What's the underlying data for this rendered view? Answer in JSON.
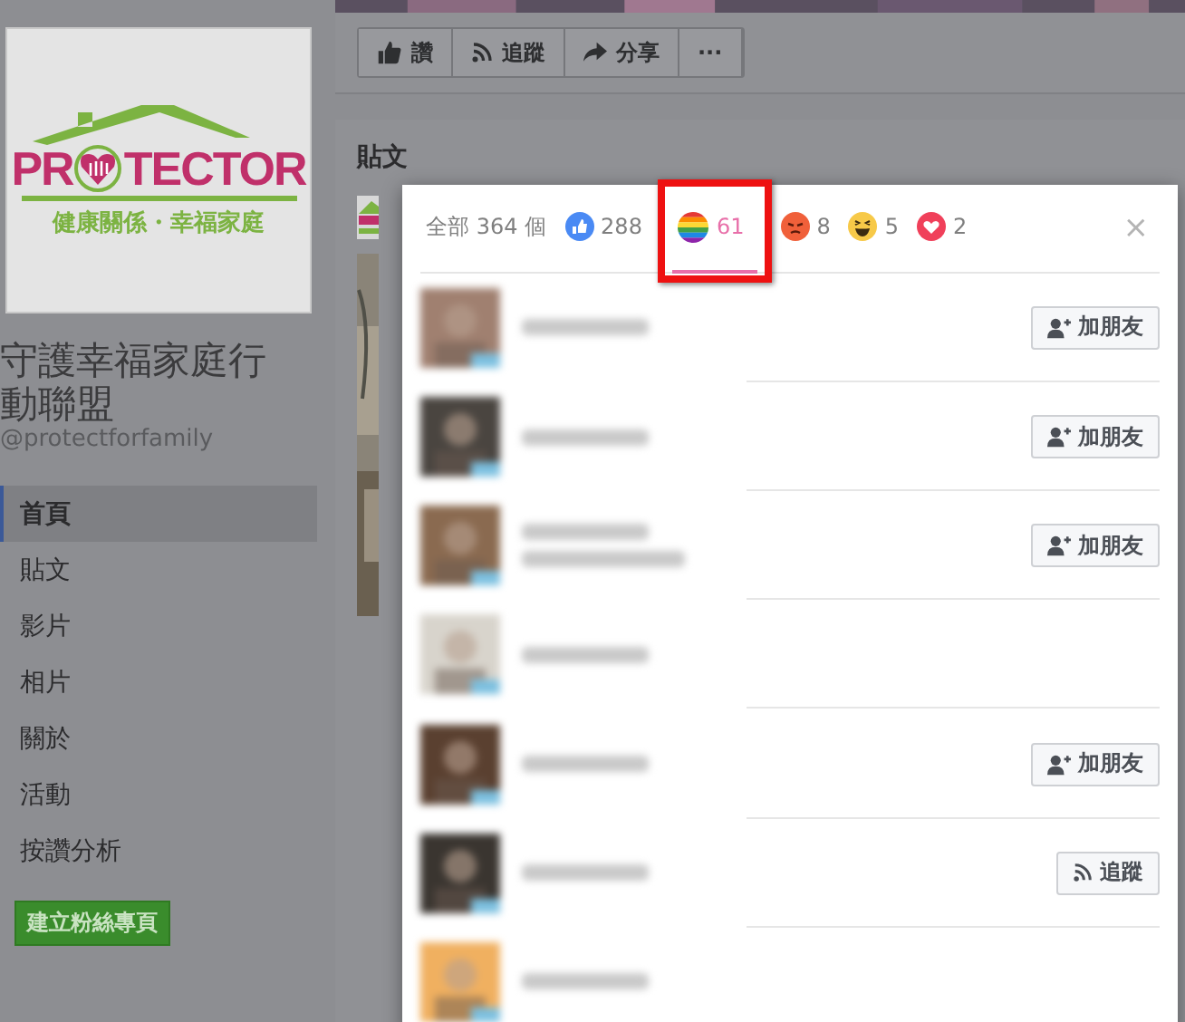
{
  "sidebar": {
    "logo": {
      "left": "PR",
      "right": "TECTOR",
      "tagline": "健康關係・幸福家庭"
    },
    "page_name": "守護幸福家庭行動聯盟",
    "handle": "@protectforfamily",
    "items": [
      {
        "label": "首頁",
        "selected": true
      },
      {
        "label": "貼文",
        "selected": false
      },
      {
        "label": "影片",
        "selected": false
      },
      {
        "label": "相片",
        "selected": false
      },
      {
        "label": "關於",
        "selected": false
      },
      {
        "label": "活動",
        "selected": false
      },
      {
        "label": "按讚分析",
        "selected": false
      }
    ],
    "create_button": "建立粉絲專頁"
  },
  "actions": [
    {
      "kind": "like",
      "label": "讚"
    },
    {
      "kind": "follow",
      "label": "追蹤"
    },
    {
      "kind": "share",
      "label": "分享"
    },
    {
      "kind": "more",
      "label": "···"
    }
  ],
  "posts_title": "貼文",
  "reactions_dialog": {
    "tabs": [
      {
        "kind": "all",
        "label": "全部 364 個",
        "selected": false,
        "highlighted": false
      },
      {
        "kind": "like",
        "label": "288",
        "selected": false,
        "highlighted": false
      },
      {
        "kind": "rainbow",
        "label": "61",
        "selected": true,
        "highlighted": true
      },
      {
        "kind": "angry",
        "label": "8",
        "selected": false,
        "highlighted": false
      },
      {
        "kind": "haha",
        "label": "5",
        "selected": false,
        "highlighted": false
      },
      {
        "kind": "love",
        "label": "2",
        "selected": false,
        "highlighted": false
      }
    ],
    "close": "×",
    "people": [
      {
        "kind": "add_friend",
        "button": "加朋友"
      },
      {
        "kind": "add_friend",
        "button": "加朋友"
      },
      {
        "kind": "add_friend",
        "button": "加朋友"
      },
      {
        "kind": "none"
      },
      {
        "kind": "add_friend",
        "button": "加朋友"
      },
      {
        "kind": "follow",
        "button": "追蹤"
      },
      {
        "kind": "none"
      }
    ]
  }
}
